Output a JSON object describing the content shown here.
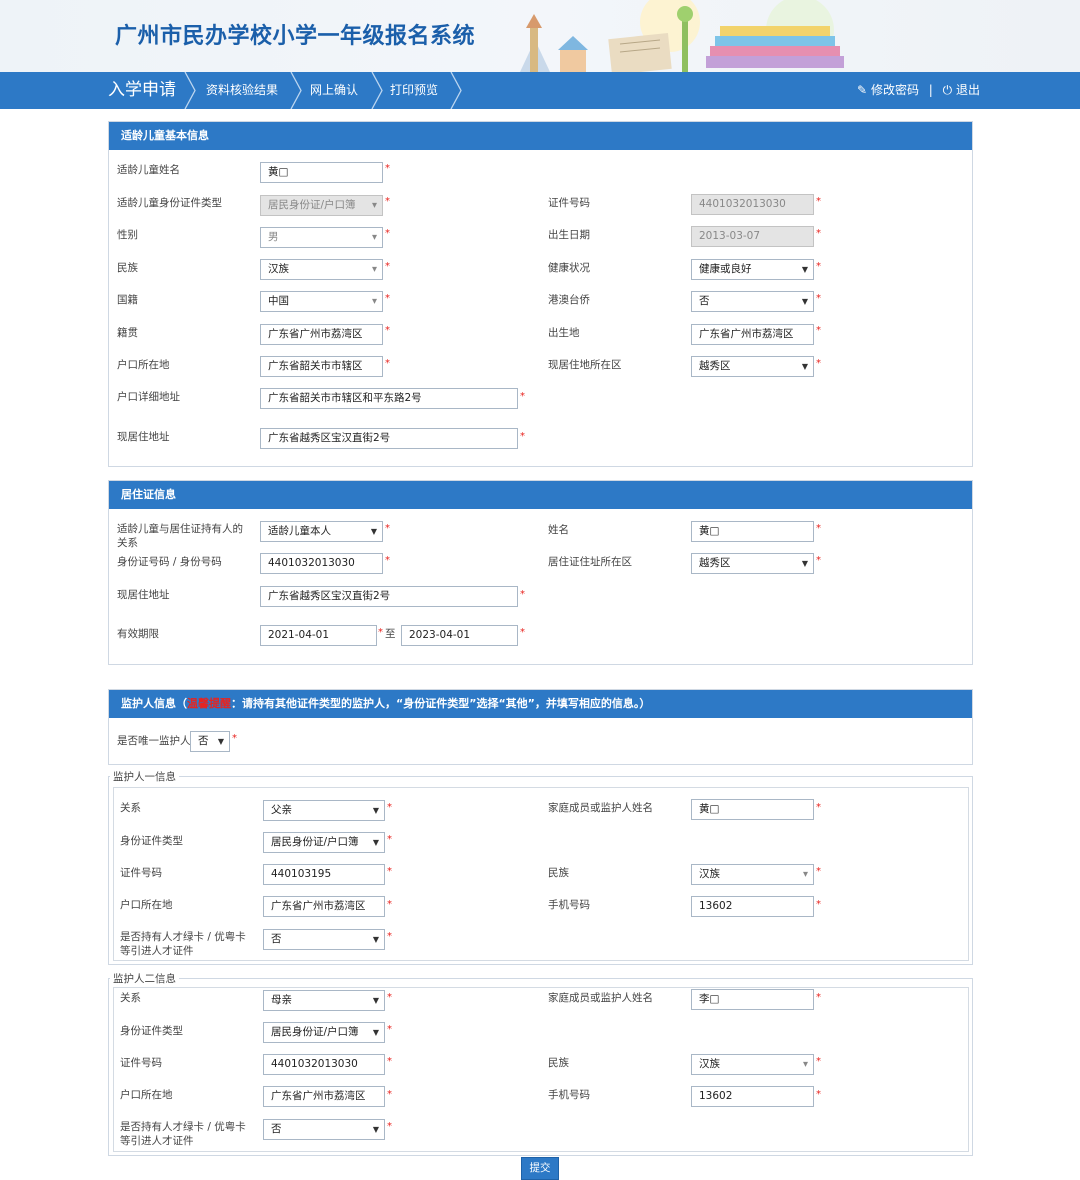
{
  "header": {
    "title": "广州市民办学校小学一年级报名系统"
  },
  "nav": {
    "steps": [
      "入学申请",
      "资料核验结果",
      "网上确认",
      "打印预览"
    ],
    "change_password": "修改密码",
    "separator": "|",
    "logout": "退出"
  },
  "child": {
    "section_title": "适龄儿童基本信息",
    "name_label": "适龄儿童姓名",
    "name_value": "黄□",
    "id_type_label": "适龄儿童身份证件类型",
    "id_type_value": "居民身份证/户口簿",
    "id_no_label": "证件号码",
    "id_no_value": "4401032013030",
    "gender_label": "性别",
    "gender_value": "男",
    "birth_label": "出生日期",
    "birth_value": "2013-03-07",
    "ethnic_label": "民族",
    "ethnic_value": "汉族",
    "health_label": "健康状况",
    "health_value": "健康或良好",
    "nationality_label": "国籍",
    "nationality_value": "中国",
    "overseas_label": "港澳台侨",
    "overseas_value": "否",
    "native_label": "籍贯",
    "native_value": "广东省广州市荔湾区",
    "birthplace_label": "出生地",
    "birthplace_value": "广东省广州市荔湾区",
    "hukou_label": "户口所在地",
    "hukou_value": "广东省韶关市市辖区",
    "residence_area_label": "现居住地所在区",
    "residence_area_value": "越秀区",
    "hukou_addr_label": "户口详细地址",
    "hukou_addr_value": "广东省韶关市市辖区和平东路2号",
    "current_addr_label": "现居住地址",
    "current_addr_value": "广东省越秀区宝汉直街2号"
  },
  "permit": {
    "section_title": "居住证信息",
    "relation_label": "适龄儿童与居住证持有人的关系",
    "relation_value": "适龄儿童本人",
    "name_label": "姓名",
    "name_value": "黄□",
    "id_label": "身份证号码 / 身份号码",
    "id_value": "4401032013030",
    "area_label": "居住证住址所在区",
    "area_value": "越秀区",
    "addr_label": "现居住地址",
    "addr_value": "广东省越秀区宝汉直街2号",
    "valid_label": "有效期限",
    "valid_from": "2021-04-01",
    "valid_to_sep": "至",
    "valid_to": "2023-04-01"
  },
  "guardian": {
    "section_title_pre": "监护人信息（",
    "section_title_alert": "温馨提醒",
    "section_title_post": "：请持有其他证件类型的监护人，“身份证件类型”选择“其他”，并填写相应的信息。）",
    "only_label": "是否唯一监护人",
    "only_value": "否",
    "g1": {
      "legend": "监护人一信息",
      "relation_label": "关系",
      "relation_value": "父亲",
      "name_label": "家庭成员或监护人姓名",
      "name_value": "黄□",
      "id_type_label": "身份证件类型",
      "id_type_value": "居民身份证/户口簿",
      "id_no_label": "证件号码",
      "id_no_value": "440103195",
      "ethnic_label": "民族",
      "ethnic_value": "汉族",
      "hukou_label": "户口所在地",
      "hukou_value": "广东省广州市荔湾区",
      "phone_label": "手机号码",
      "phone_value": "13602",
      "talent_label": "是否持有人才绿卡 / 优粤卡等引进人才证件",
      "talent_value": "否"
    },
    "g2": {
      "legend": "监护人二信息",
      "relation_label": "关系",
      "relation_value": "母亲",
      "name_label": "家庭成员或监护人姓名",
      "name_value": "李□",
      "id_type_label": "身份证件类型",
      "id_type_value": "居民身份证/户口簿",
      "id_no_label": "证件号码",
      "id_no_value": "4401032013030",
      "ethnic_label": "民族",
      "ethnic_value": "汉族",
      "hukou_label": "户口所在地",
      "hukou_value": "广东省广州市荔湾区",
      "phone_label": "手机号码",
      "phone_value": "13602",
      "talent_label": "是否持有人才绿卡 / 优粤卡等引进人才证件",
      "talent_value": "否"
    }
  },
  "submit_label": "提交",
  "colors": {
    "brand": "#2d79c6",
    "title": "#1b5faa",
    "required": "#e8231f"
  }
}
